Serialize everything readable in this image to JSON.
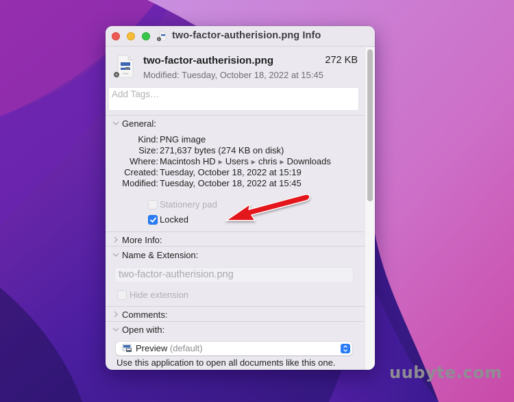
{
  "window": {
    "title": "two-factor-autherision.png Info",
    "traffic_lights": [
      "close",
      "minimize",
      "zoom"
    ]
  },
  "file": {
    "name": "two-factor-autherision.png",
    "size": "272 KB",
    "modified_label": "Modified:",
    "modified_value": "Tuesday, October 18, 2022 at 15:45",
    "icon": "png-file-icon"
  },
  "tags": {
    "placeholder": "Add Tags…"
  },
  "general": {
    "label": "General:",
    "expanded": true,
    "kind_label": "Kind:",
    "kind": "PNG image",
    "size_label": "Size:",
    "size": "271,637 bytes (274 KB on disk)",
    "where_label": "Where:",
    "where": [
      "Macintosh HD",
      "Users",
      "chris",
      "Downloads"
    ],
    "created_label": "Created:",
    "created": "Tuesday, October 18, 2022 at 15:19",
    "modified_label": "Modified:",
    "modified": "Tuesday, October 18, 2022 at 15:45",
    "stationery_pad_label": "Stationery pad",
    "stationery_pad_checked": false,
    "stationery_pad_enabled": false,
    "locked_label": "Locked",
    "locked_checked": true
  },
  "more_info": {
    "label": "More Info:",
    "expanded": false
  },
  "name_extension": {
    "label": "Name & Extension:",
    "expanded": true,
    "value": "two-factor-autherision.png",
    "hide_extension_label": "Hide extension",
    "hide_extension_checked": false
  },
  "comments": {
    "label": "Comments:",
    "expanded": false
  },
  "open_with": {
    "label": "Open with:",
    "expanded": true,
    "app": "Preview",
    "app_suffix": "(default)",
    "description": "Use this application to open all documents like this one."
  },
  "annotation": {
    "arrow_color": "#e3161b",
    "points_to": "Locked"
  },
  "watermark": "uubyte.com",
  "colors": {
    "accent": "#2a7cf6",
    "close": "#ee5a55",
    "minimize": "#f6bd3a",
    "zoom": "#37c64a"
  }
}
